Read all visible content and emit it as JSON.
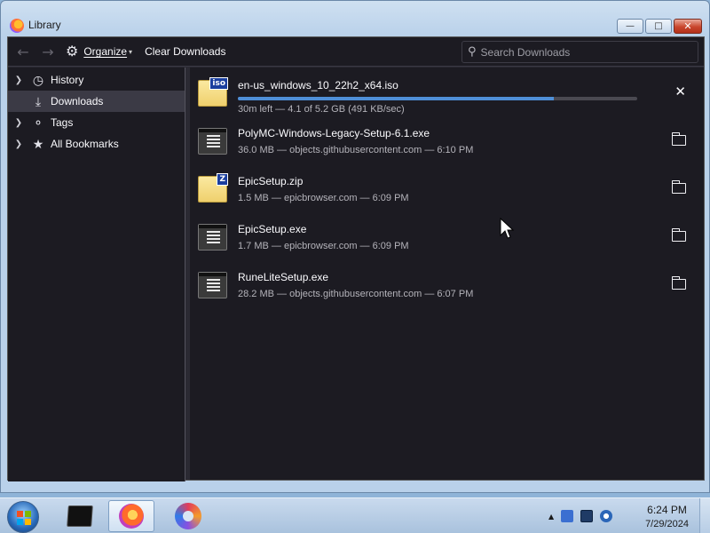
{
  "window": {
    "title": "Library",
    "caption": {
      "minimize": "▭",
      "maximize": "□",
      "close": "✕"
    }
  },
  "toolbar": {
    "back_icon": "arrow-left-icon",
    "forward_icon": "arrow-right-icon",
    "organize_label": "Organize",
    "clear_label": "Clear Downloads",
    "search_placeholder": "Search Downloads"
  },
  "sidebar": {
    "items": [
      {
        "label": "History",
        "icon": "clock-icon",
        "expandable": true,
        "selected": false
      },
      {
        "label": "Downloads",
        "icon": "download-icon",
        "expandable": false,
        "selected": true
      },
      {
        "label": "Tags",
        "icon": "tag-icon",
        "expandable": true,
        "selected": false
      },
      {
        "label": "All Bookmarks",
        "icon": "star-icon",
        "expandable": true,
        "selected": false
      }
    ]
  },
  "downloads": [
    {
      "name": "en-us_windows_10_22h2_x64.iso",
      "status": "30m left — 4.1 of 5.2 GB (491 KB/sec)",
      "progress": 0.79,
      "in_progress": true,
      "icon": "iso-file-icon",
      "badge": "iso"
    },
    {
      "name": "PolyMC-Windows-Legacy-Setup-6.1.exe",
      "status": "36.0 MB — objects.githubusercontent.com — 6:10 PM",
      "in_progress": false,
      "icon": "exe-file-icon"
    },
    {
      "name": "EpicSetup.zip",
      "status": "1.5 MB — epicbrowser.com — 6:09 PM",
      "in_progress": false,
      "icon": "zip-file-icon",
      "badge": "Z"
    },
    {
      "name": "EpicSetup.exe",
      "status": "1.7 MB — epicbrowser.com — 6:09 PM",
      "in_progress": false,
      "icon": "exe-file-icon"
    },
    {
      "name": "RuneLiteSetup.exe",
      "status": "28.2 MB — objects.githubusercontent.com — 6:07 PM",
      "in_progress": false,
      "icon": "exe-file-icon"
    }
  ],
  "colors": {
    "progress_fill": "#4f8fd8",
    "selected_bg": "#3b3a45",
    "panel_bg": "#1c1b22"
  },
  "taskbar": {
    "clock_time": "6:24 PM",
    "clock_date": "7/29/2024",
    "apps": [
      "terminal-icon",
      "firefox-icon",
      "browser-icon"
    ]
  }
}
